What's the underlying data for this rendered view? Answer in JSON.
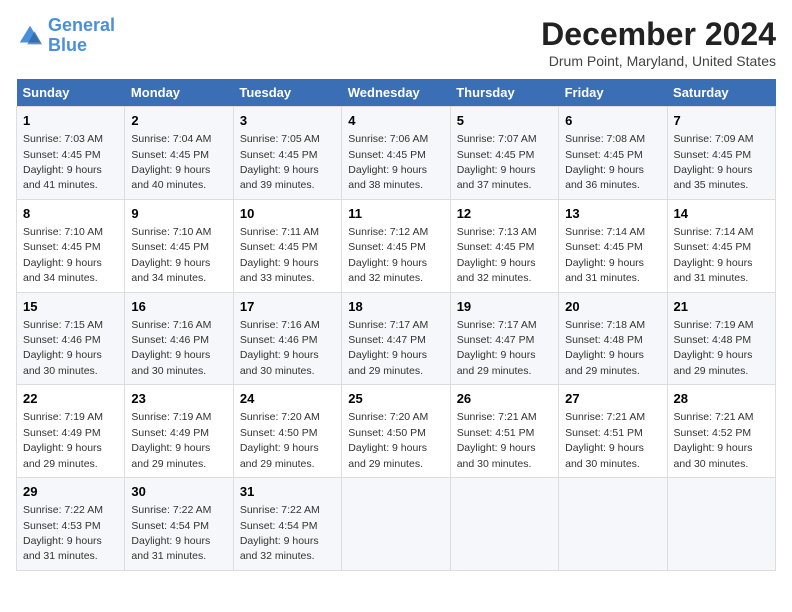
{
  "header": {
    "logo_line1": "General",
    "logo_line2": "Blue",
    "title": "December 2024",
    "subtitle": "Drum Point, Maryland, United States"
  },
  "days_of_week": [
    "Sunday",
    "Monday",
    "Tuesday",
    "Wednesday",
    "Thursday",
    "Friday",
    "Saturday"
  ],
  "weeks": [
    [
      {
        "day": "1",
        "sunrise": "7:03 AM",
        "sunset": "4:45 PM",
        "daylight": "9 hours and 41 minutes."
      },
      {
        "day": "2",
        "sunrise": "7:04 AM",
        "sunset": "4:45 PM",
        "daylight": "9 hours and 40 minutes."
      },
      {
        "day": "3",
        "sunrise": "7:05 AM",
        "sunset": "4:45 PM",
        "daylight": "9 hours and 39 minutes."
      },
      {
        "day": "4",
        "sunrise": "7:06 AM",
        "sunset": "4:45 PM",
        "daylight": "9 hours and 38 minutes."
      },
      {
        "day": "5",
        "sunrise": "7:07 AM",
        "sunset": "4:45 PM",
        "daylight": "9 hours and 37 minutes."
      },
      {
        "day": "6",
        "sunrise": "7:08 AM",
        "sunset": "4:45 PM",
        "daylight": "9 hours and 36 minutes."
      },
      {
        "day": "7",
        "sunrise": "7:09 AM",
        "sunset": "4:45 PM",
        "daylight": "9 hours and 35 minutes."
      }
    ],
    [
      {
        "day": "8",
        "sunrise": "7:10 AM",
        "sunset": "4:45 PM",
        "daylight": "9 hours and 34 minutes."
      },
      {
        "day": "9",
        "sunrise": "7:10 AM",
        "sunset": "4:45 PM",
        "daylight": "9 hours and 34 minutes."
      },
      {
        "day": "10",
        "sunrise": "7:11 AM",
        "sunset": "4:45 PM",
        "daylight": "9 hours and 33 minutes."
      },
      {
        "day": "11",
        "sunrise": "7:12 AM",
        "sunset": "4:45 PM",
        "daylight": "9 hours and 32 minutes."
      },
      {
        "day": "12",
        "sunrise": "7:13 AM",
        "sunset": "4:45 PM",
        "daylight": "9 hours and 32 minutes."
      },
      {
        "day": "13",
        "sunrise": "7:14 AM",
        "sunset": "4:45 PM",
        "daylight": "9 hours and 31 minutes."
      },
      {
        "day": "14",
        "sunrise": "7:14 AM",
        "sunset": "4:45 PM",
        "daylight": "9 hours and 31 minutes."
      }
    ],
    [
      {
        "day": "15",
        "sunrise": "7:15 AM",
        "sunset": "4:46 PM",
        "daylight": "9 hours and 30 minutes."
      },
      {
        "day": "16",
        "sunrise": "7:16 AM",
        "sunset": "4:46 PM",
        "daylight": "9 hours and 30 minutes."
      },
      {
        "day": "17",
        "sunrise": "7:16 AM",
        "sunset": "4:46 PM",
        "daylight": "9 hours and 30 minutes."
      },
      {
        "day": "18",
        "sunrise": "7:17 AM",
        "sunset": "4:47 PM",
        "daylight": "9 hours and 29 minutes."
      },
      {
        "day": "19",
        "sunrise": "7:17 AM",
        "sunset": "4:47 PM",
        "daylight": "9 hours and 29 minutes."
      },
      {
        "day": "20",
        "sunrise": "7:18 AM",
        "sunset": "4:48 PM",
        "daylight": "9 hours and 29 minutes."
      },
      {
        "day": "21",
        "sunrise": "7:19 AM",
        "sunset": "4:48 PM",
        "daylight": "9 hours and 29 minutes."
      }
    ],
    [
      {
        "day": "22",
        "sunrise": "7:19 AM",
        "sunset": "4:49 PM",
        "daylight": "9 hours and 29 minutes."
      },
      {
        "day": "23",
        "sunrise": "7:19 AM",
        "sunset": "4:49 PM",
        "daylight": "9 hours and 29 minutes."
      },
      {
        "day": "24",
        "sunrise": "7:20 AM",
        "sunset": "4:50 PM",
        "daylight": "9 hours and 29 minutes."
      },
      {
        "day": "25",
        "sunrise": "7:20 AM",
        "sunset": "4:50 PM",
        "daylight": "9 hours and 29 minutes."
      },
      {
        "day": "26",
        "sunrise": "7:21 AM",
        "sunset": "4:51 PM",
        "daylight": "9 hours and 30 minutes."
      },
      {
        "day": "27",
        "sunrise": "7:21 AM",
        "sunset": "4:51 PM",
        "daylight": "9 hours and 30 minutes."
      },
      {
        "day": "28",
        "sunrise": "7:21 AM",
        "sunset": "4:52 PM",
        "daylight": "9 hours and 30 minutes."
      }
    ],
    [
      {
        "day": "29",
        "sunrise": "7:22 AM",
        "sunset": "4:53 PM",
        "daylight": "9 hours and 31 minutes."
      },
      {
        "day": "30",
        "sunrise": "7:22 AM",
        "sunset": "4:54 PM",
        "daylight": "9 hours and 31 minutes."
      },
      {
        "day": "31",
        "sunrise": "7:22 AM",
        "sunset": "4:54 PM",
        "daylight": "9 hours and 32 minutes."
      },
      null,
      null,
      null,
      null
    ]
  ]
}
